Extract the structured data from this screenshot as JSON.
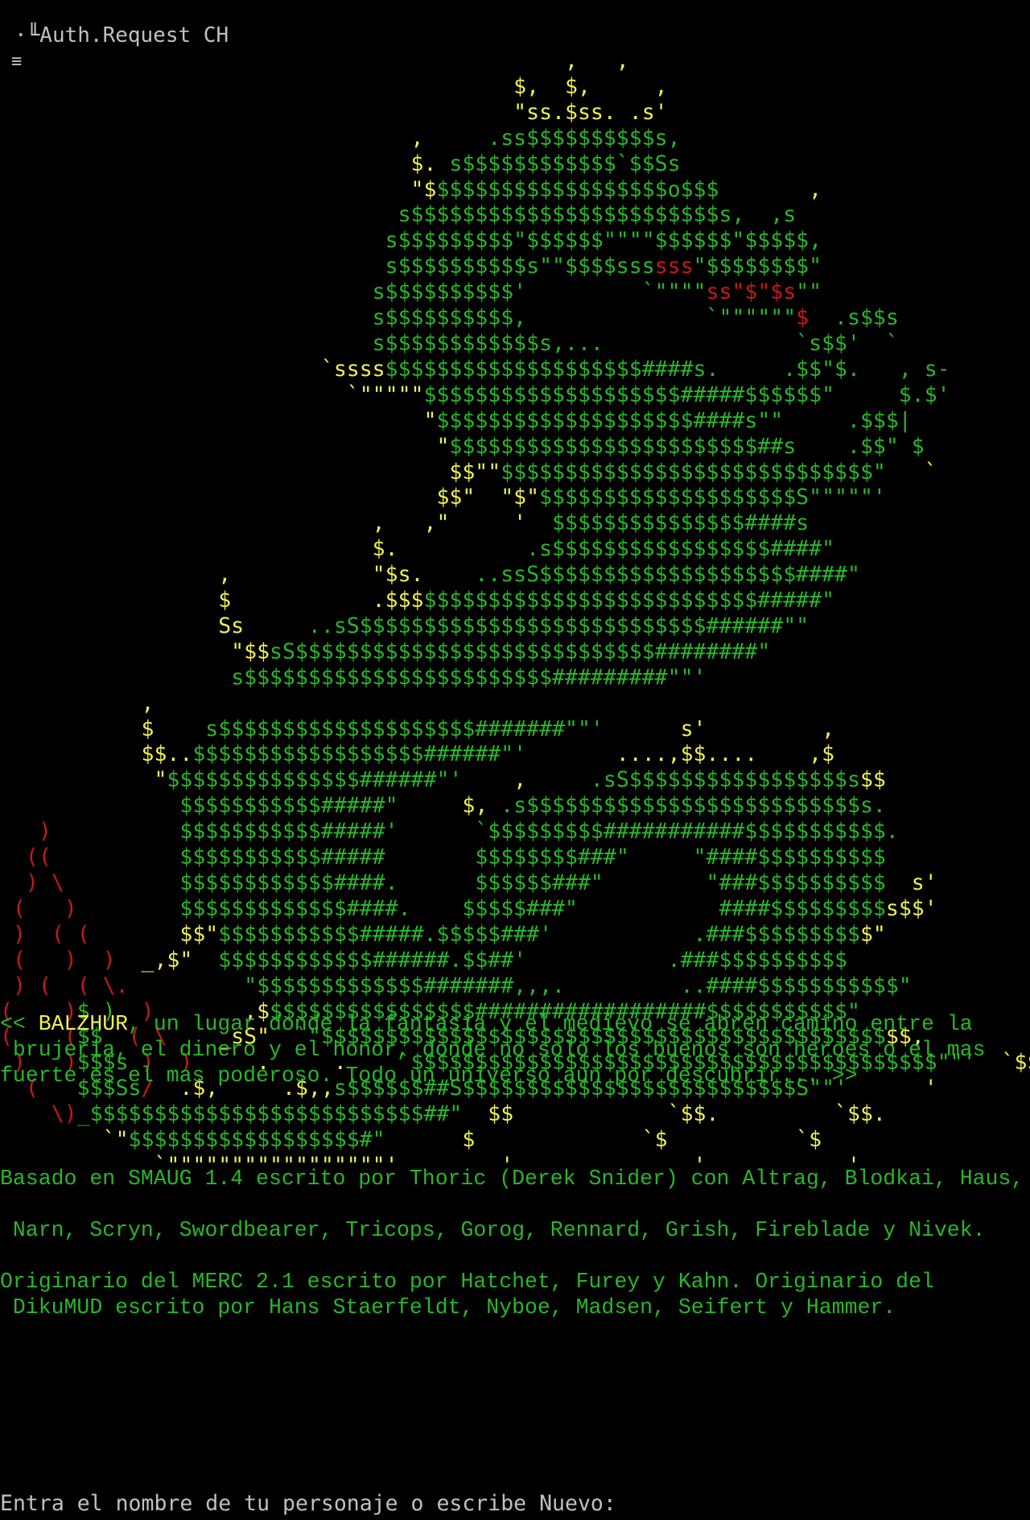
{
  "header": {
    "title": "·╙Auth.Request CH",
    "menu_icon": "≡"
  },
  "colors": {
    "background": "#000000",
    "green": "#29b629",
    "yellow": "#f0f050",
    "red": "#c81818",
    "gray": "#c0c0c0"
  },
  "banner_lines": [
    [
      [
        "y",
        "                                            ,   ,"
      ]
    ],
    [
      [
        "y",
        "                                        $,  $,     ,"
      ]
    ],
    [
      [
        "y",
        "                                        \"ss.$ss. .s'"
      ]
    ],
    [
      [
        "y",
        "                                ,     "
      ],
      [
        "g",
        ".ss$$$$$$$$$$s,"
      ]
    ],
    [
      [
        "y",
        "                                $. "
      ],
      [
        "g",
        "s$$$$$$$$$$$$`$$Ss"
      ]
    ],
    [
      [
        "y",
        "                                \"$"
      ],
      [
        "g",
        "$$$$$$$$$$$$$$$$$$o$$$"
      ],
      [
        "y",
        "       ,"
      ]
    ],
    [
      [
        "g",
        "                               s$$$$$$$$$$$$$$$$$$$$$$$$s,  ,s"
      ]
    ],
    [
      [
        "g",
        "                              s$$$$$$$$$\"$$$$$$\"\"\"\"$$$$$$\"$$$$$,"
      ]
    ],
    [
      [
        "g",
        "                              s$$$$$$$$$$s\"\"$$$$sss"
      ],
      [
        "r",
        "sss"
      ],
      [
        "g",
        "\"$$$$$$$$\""
      ]
    ],
    [
      [
        "g",
        "                             s$$$$$$$$$$'         `\"\"\"\""
      ],
      [
        "r",
        "ss\"$\"$s"
      ],
      [
        "g",
        "\"\""
      ]
    ],
    [
      [
        "g",
        "                             s$$$$$$$$$$,              `\"\"\"\"\"\""
      ],
      [
        "r",
        "$"
      ],
      [
        "g",
        "  .s$$s"
      ]
    ],
    [
      [
        "g",
        "                             s$$$$$$$$$$$$s,...               `s$$'  `"
      ]
    ],
    [
      [
        "y",
        "                         `ssss"
      ],
      [
        "g",
        "$$$$$$$$$$$$$$$$$$$$####s.     .$$\"$.   , s-"
      ]
    ],
    [
      [
        "y",
        "                           `\"\"\"\"\""
      ],
      [
        "g",
        "$$$$$$$$$$$$$$$$$$$$#####$$$$$$\"     $.$'"
      ]
    ],
    [
      [
        "y",
        "                                 \""
      ],
      [
        "g",
        "$$$$$$$$$$$$$$$$$$$$####s\"\"     .$$$|"
      ]
    ],
    [
      [
        "y",
        "                                  \""
      ],
      [
        "g",
        "$$$$$$$$$$$$$$$$$$$$$$$$##s    .$$\" $"
      ]
    ],
    [
      [
        "y",
        "                                   $$\"\""
      ],
      [
        "g",
        "$$$$$$$$$$$$$$$$$$$$$$$$$$$$$\""
      ],
      [
        "y",
        "   `"
      ]
    ],
    [
      [
        "y",
        "                                  $$\"  \"$\""
      ],
      [
        "g",
        "$$$$$$$$$$$$$$$$$$$$S\"\"\"\"\"'"
      ]
    ],
    [
      [
        "y",
        "                             ,   ,\"     '  "
      ],
      [
        "g",
        "$$$$$$$$$$$$$$$####s"
      ]
    ],
    [
      [
        "y",
        "                             $.          "
      ],
      [
        "g",
        ".s$$$$$$$$$$$$$$$$$####\""
      ]
    ],
    [
      [
        "y",
        "                 ,           \"$s.    "
      ],
      [
        "g",
        "..ssS$$$$$$$$$$$$$$$$$$$$####\""
      ]
    ],
    [
      [
        "y",
        "                 $           .$$$"
      ],
      [
        "g",
        "$$$$$$$$$$$$$$$$$$$$$$$$$$#####\""
      ]
    ],
    [
      [
        "y",
        "                 Ss     "
      ],
      [
        "g",
        "..sS$$$$$$$$$$$$$$$$$$$$$$$$$$$######\"\""
      ]
    ],
    [
      [
        "y",
        "                  \"$$"
      ],
      [
        "g",
        "sS$$$$$$$$$$$$$$$$$$$$$$$$$$$$########\""
      ]
    ],
    [
      [
        "y",
        "                  "
      ],
      [
        "g",
        "s$$$$$$$$$$$$$$$$$$$$$$$$#########\"\"'"
      ]
    ],
    [
      [
        "y",
        "           ,"
      ]
    ],
    [
      [
        "y",
        "           $    "
      ],
      [
        "g",
        "s$$$$$$$$$$$$$$$$$$$$#######\"\"'      "
      ],
      [
        "y",
        "s'         ,"
      ]
    ],
    [
      [
        "y",
        "           $$.."
      ],
      [
        "g",
        "$$$$$$$$$$$$$$$$$$######\"'       "
      ],
      [
        "y",
        "....,$$....    ,$"
      ]
    ],
    [
      [
        "y",
        "            \""
      ],
      [
        "g",
        "$$$$$$$$$$$$$$$######\"' "
      ],
      [
        "y",
        "   ,     "
      ],
      [
        "g",
        ".sS$$$$$$$$$$$$$$$$$s"
      ],
      [
        "y",
        "$$"
      ]
    ],
    [
      [
        "g",
        "              $$$$$$$$$$$#####\"     "
      ],
      [
        "y",
        "$,"
      ],
      [
        "g",
        " .s$$$$$$$$$$$$$$$$$$$$$$$$$$s."
      ]
    ],
    [
      [
        "r",
        "   )"
      ],
      [
        "g",
        "          $$$$$$$$$$$#####'      `$$$$$$$$$###########$$$$$$$$$$$."
      ]
    ],
    [
      [
        "r",
        "  (("
      ],
      [
        "g",
        "          $$$$$$$$$$$#####       $$$$$$$$###\"     \"####$$$$$$$$$$"
      ]
    ],
    [
      [
        "r",
        "  ) \\"
      ],
      [
        "g",
        "         $$$$$$$$$$$$####.      $$$$$$###\"        \"###$$$$$$$$$$"
      ],
      [
        "y",
        "  s'"
      ]
    ],
    [
      [
        "r",
        " (   )"
      ],
      [
        "g",
        "        $$$$$$$$$$$$$####.    $$$$$###\"           ####$$$$$$$$$"
      ],
      [
        "y",
        "s$$'"
      ]
    ],
    [
      [
        "r",
        " )  ( ("
      ],
      [
        "g",
        "       "
      ],
      [
        "y",
        "$$\""
      ],
      [
        "g",
        "$$$$$$$$$$$#####.$$$$$###'           .###$$$$$$$$$"
      ],
      [
        "y",
        "$\""
      ]
    ],
    [
      [
        "r",
        " (   )  )"
      ],
      [
        "y",
        "  _,$\""
      ],
      [
        "g",
        "  $$$$$$$$$$$$######.$$##'           .###$$$$$$$$$$"
      ]
    ],
    [
      [
        "r",
        " ) (  ( \\."
      ],
      [
        "g",
        "         \"$$$$$$$$$$$$$#######,,,.         ..####$$$$$$$$$$$\""
      ]
    ],
    [
      [
        "r",
        "(    )"
      ],
      [
        "g",
        "$ )  "
      ],
      [
        "r",
        ")"
      ],
      [
        "y",
        "       ,$"
      ],
      [
        "g",
        "$$$$$$$$$$$$$$$$##################$$$$$$$$$$$\""
      ]
    ],
    [
      [
        "r",
        "(    ("
      ],
      [
        "g",
        "$$  "
      ],
      [
        "r",
        "( \\"
      ],
      [
        "y",
        "    _sS\"  "
      ],
      [
        "g",
        "`\"$$$$$$$$$$$$$$$$$$$$$$$$$$$$$$$$$$$$$$$$$$$$"
      ],
      [
        "y",
        "$$,"
      ]
    ],
    [
      [
        "r",
        " )   )"
      ],
      [
        "g",
        "$$$s "
      ],
      [
        "r",
        ")  )"
      ],
      [
        "y",
        "     .     .    "
      ],
      [
        "g",
        "`$$$$$$$$$$$$$$$$$$$$$$$$$$$$$$$$$$$$$$$$$\"\"'"
      ],
      [
        "y",
        "  `$$"
      ]
    ],
    [
      [
        "r",
        "  (   "
      ],
      [
        "g",
        "$$$Ss"
      ],
      [
        "r",
        "/"
      ],
      [
        "y",
        "  .$,     .$,,"
      ],
      [
        "g",
        "s$$$$$$##S$$$$$$$$$$$$$$$$$$$$$$$$$$S\"\"'"
      ],
      [
        "y",
        "      '"
      ]
    ],
    [
      [
        "r",
        "    \\)"
      ],
      [
        "g",
        "_$$$$$$$$$$$$$$$$$$$$$$$$$$##\""
      ],
      [
        "y",
        "  $$            `$$.         `$$."
      ]
    ],
    [
      [
        "y",
        "        `\""
      ],
      [
        "g",
        "$$$$$$$$$$$$$$$$$$#\""
      ],
      [
        "y",
        "      $             `$          `$"
      ]
    ],
    [
      [
        "y",
        "            `\"\"\"\"\"\"\"\"\"\"\"\"\"\"\"\"\"'        '              '           '"
      ]
    ]
  ],
  "intro": {
    "open": "<< ",
    "name": "BALZHUR",
    "line1_rest": ", un lugar donde la fantasia y el medievo se abren camino entre la",
    "line2": " brujeria, el dinero y el honor, donde no solo los buenos son heroes o el mas",
    "line3": "fuerte es el mas poderoso. Todo un universo aun por descubrir... >>"
  },
  "credits": {
    "line1": "Basado en SMAUG 1.4 escrito por Thoric (Derek Snider) con Altrag, Blodkai, Haus,",
    "line2": " Narn, Scryn, Swordbearer, Tricops, Gorog, Rennard, Grish, Fireblade y Nivek.",
    "line3": "Originario del MERC 2.1 escrito por Hatchet, Furey y Kahn. Originario del",
    "line4": " DikuMUD escrito por Hans Staerfeldt, Nyboe, Madsen, Seifert y Hammer."
  },
  "prompt": {
    "text": "Entra el nombre de tu personaje o escribe Nuevo:"
  }
}
